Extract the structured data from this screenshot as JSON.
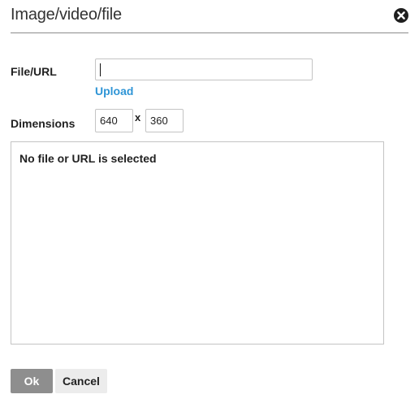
{
  "dialog": {
    "title": "Image/video/file",
    "close_icon": "close-circle-icon"
  },
  "form": {
    "file_label": "File/URL",
    "url_value": "",
    "upload_label": "Upload",
    "dimensions_label": "Dimensions",
    "width_value": "640",
    "separator": "x",
    "height_value": "360"
  },
  "preview": {
    "message": "No file or URL is selected"
  },
  "footer": {
    "ok_label": "Ok",
    "cancel_label": "Cancel"
  },
  "colors": {
    "link": "#2f95d6",
    "ok_button_bg": "#8e8e8e",
    "cancel_button_bg": "#ececec",
    "title_rule": "#8c8c8c"
  }
}
